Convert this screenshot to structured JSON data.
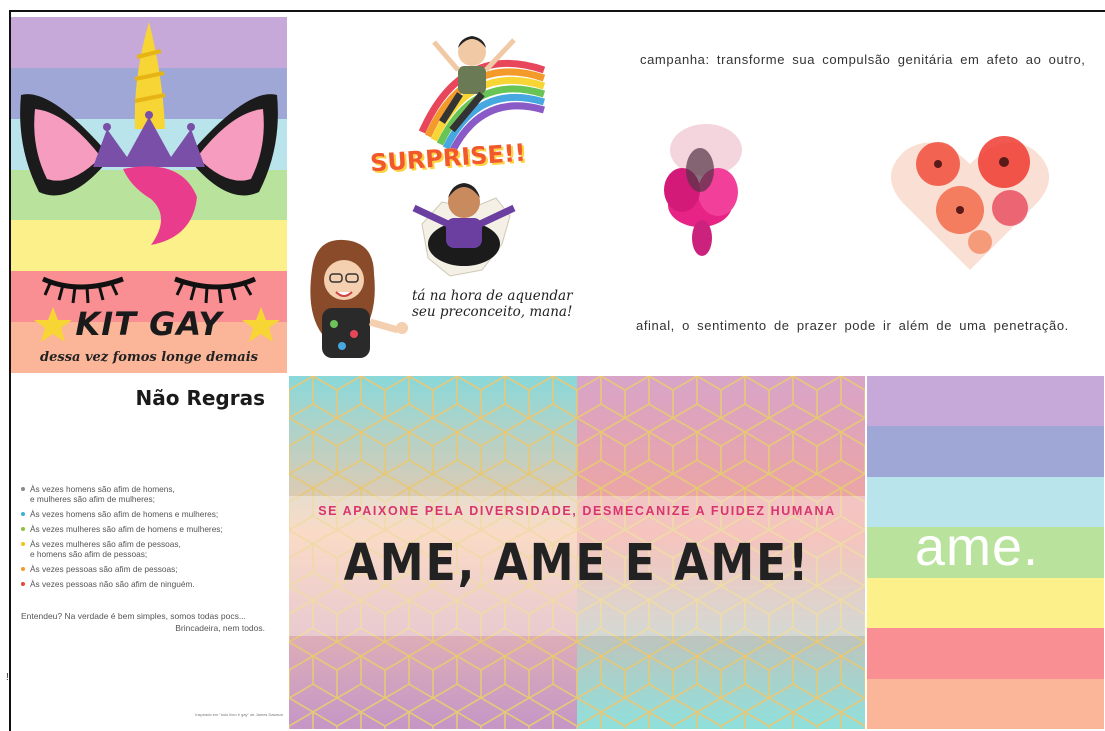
{
  "unicorn": {
    "title": "KIT GAY",
    "subtitle": "dessa vez fomos longe demais",
    "stripe_colors": [
      "#c6a9d9",
      "#9ea7d6",
      "#b9e4ec",
      "#b9e39c",
      "#fbf08a",
      "#f98f92",
      "#fbb69a"
    ]
  },
  "bitmoji": {
    "surprise": "SURPRISE!!",
    "caption_line1": "tá na hora de aquendar",
    "caption_line2": "seu preconceito, mana!"
  },
  "campaign": {
    "top": "campanha: transforme sua compulsão genitária em afeto ao outro,",
    "bottom": "afinal, o sentimento de prazer pode ir além de uma penetração."
  },
  "regras": {
    "title": "Não Regras",
    "rules": [
      {
        "line1": "Às vezes homens são afim de homens,",
        "line2": "e mulheres são afim de mulheres;",
        "color": "#8a8a8a"
      },
      {
        "line1": "Às vezes homens são afim de homens e mulheres;",
        "line2": "",
        "color": "#3fb1d9"
      },
      {
        "line1": "Às vezes mulheres são afim de homens e mulheres;",
        "line2": "",
        "color": "#8fc23f"
      },
      {
        "line1": "Às vezes mulheres são afim de pessoas,",
        "line2": "e homens são afim de pessoas;",
        "color": "#f2c417"
      },
      {
        "line1": "Às vezes pessoas são afim de pessoas;",
        "line2": "",
        "color": "#f39a2b"
      },
      {
        "line1": "Às vezes pessoas não são afim de ninguém.",
        "line2": "",
        "color": "#e6493c"
      }
    ],
    "ending1": "Entendeu? Na verdade é bem simples, somos todas pocs...",
    "ending2": "Brincadeira, nem todos.",
    "credit": "Inspirado em \"solo livro é gay\" de James Dawson"
  },
  "ame_panel": {
    "tagline": "SE APAIXONE PELA DIVERSIDADE, DESMECANIZE A FUIDEZ HUMANA",
    "headline": "AME, AME E AME!"
  },
  "ame_stripes": {
    "word": "ame.",
    "colors": [
      "#c6a9d9",
      "#9ea7d6",
      "#b9e4ec",
      "#b9e39c",
      "#fbf08a",
      "#f98f92",
      "#fbb69a"
    ]
  },
  "sidemark": "!"
}
